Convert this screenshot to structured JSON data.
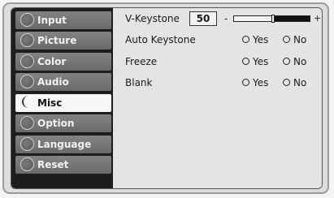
{
  "menu": {
    "items": [
      {
        "label": "Input",
        "active": false
      },
      {
        "label": "Picture",
        "active": false
      },
      {
        "label": "Color",
        "active": false
      },
      {
        "label": "Audio",
        "active": false
      },
      {
        "label": "Misc",
        "active": true
      },
      {
        "label": "Option",
        "active": false
      },
      {
        "label": "Language",
        "active": false
      },
      {
        "label": "Reset",
        "active": false
      }
    ]
  },
  "settings": {
    "v_keystone": {
      "label": "V-Keystone",
      "value": "50",
      "minus": "-",
      "plus": "+",
      "level_fraction": 0.5
    },
    "auto_keystone": {
      "label": "Auto Keystone",
      "yes": "Yes",
      "no": "No"
    },
    "freeze": {
      "label": "Freeze",
      "yes": "Yes",
      "no": "No"
    },
    "blank": {
      "label": "Blank",
      "yes": "Yes",
      "no": "No"
    }
  },
  "colors": {
    "sidebar_bg": "#1d1d1d",
    "active_item_bg": "#f7f7f7",
    "content_bg": "#e4e4e4"
  }
}
